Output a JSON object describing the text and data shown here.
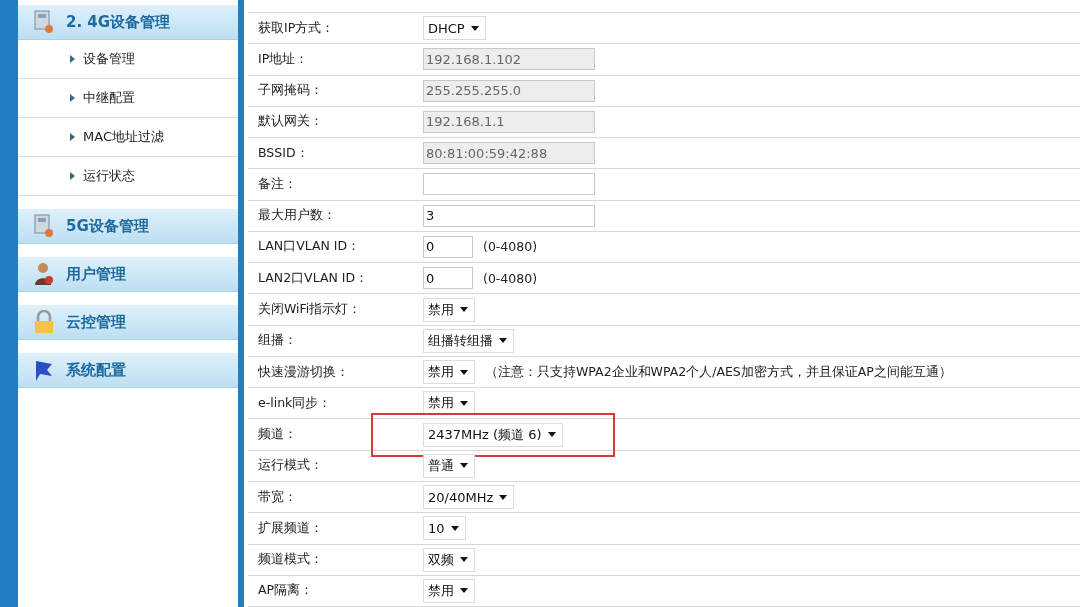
{
  "sidebar": {
    "sections": [
      {
        "label": "2. 4G设备管理",
        "items": [
          {
            "label": "设备管理"
          },
          {
            "label": "中继配置"
          },
          {
            "label": "MAC地址过滤"
          },
          {
            "label": "运行状态"
          }
        ]
      },
      {
        "label": "5G设备管理"
      },
      {
        "label": "用户管理"
      },
      {
        "label": "云控管理"
      },
      {
        "label": "系统配置"
      }
    ]
  },
  "form": {
    "rows": [
      {
        "label": "获取IP方式：",
        "kind": "select",
        "value": "DHCP",
        "highlighted": false
      },
      {
        "label": "IP地址：",
        "kind": "input",
        "value": "192.168.1.102",
        "disabled": true,
        "highlighted": false
      },
      {
        "label": "子网掩码：",
        "kind": "input",
        "value": "255.255.255.0",
        "disabled": true,
        "highlighted": false
      },
      {
        "label": "默认网关：",
        "kind": "input",
        "value": "192.168.1.1",
        "disabled": true,
        "highlighted": false
      },
      {
        "label": "BSSID：",
        "kind": "input",
        "value": "80:81:00:59:42:88",
        "disabled": true,
        "highlighted": false
      },
      {
        "label": "备注：",
        "kind": "input",
        "value": "",
        "disabled": false,
        "highlighted": false
      },
      {
        "label": "最大用户数：",
        "kind": "input",
        "value": "3",
        "disabled": false,
        "highlighted": false
      },
      {
        "label": "LAN口VLAN ID：",
        "kind": "short-input",
        "value": "0",
        "disabled": false,
        "note": "(0-4080)",
        "highlighted": false
      },
      {
        "label": "LAN2口VLAN ID：",
        "kind": "short-input",
        "value": "0",
        "disabled": false,
        "note": "(0-4080)",
        "highlighted": false
      },
      {
        "label": "关闭WiFi指示灯：",
        "kind": "select",
        "value": "禁用",
        "highlighted": false
      },
      {
        "label": "组播：",
        "kind": "select",
        "value": "组播转组播",
        "highlighted": false
      },
      {
        "label": "快速漫游切换：",
        "kind": "select",
        "value": "禁用",
        "note": "（注意：只支持WPA2企业和WPA2个人/AES加密方式，并且保证AP之间能互通）",
        "highlighted": false
      },
      {
        "label": "e-link同步：",
        "kind": "select",
        "value": "禁用",
        "highlighted": false
      },
      {
        "label": "频道：",
        "kind": "select",
        "value": "2437MHz (频道 6)",
        "highlighted": true
      },
      {
        "label": "运行模式：",
        "kind": "select",
        "value": "普通",
        "highlighted": false
      },
      {
        "label": "带宽：",
        "kind": "select",
        "value": "20/40MHz",
        "highlighted": false
      },
      {
        "label": "扩展频道：",
        "kind": "select",
        "value": "10",
        "highlighted": false
      },
      {
        "label": "频道模式：",
        "kind": "select",
        "value": "双频",
        "highlighted": false
      },
      {
        "label": "AP隔离：",
        "kind": "select",
        "value": "禁用",
        "highlighted": false
      }
    ]
  }
}
